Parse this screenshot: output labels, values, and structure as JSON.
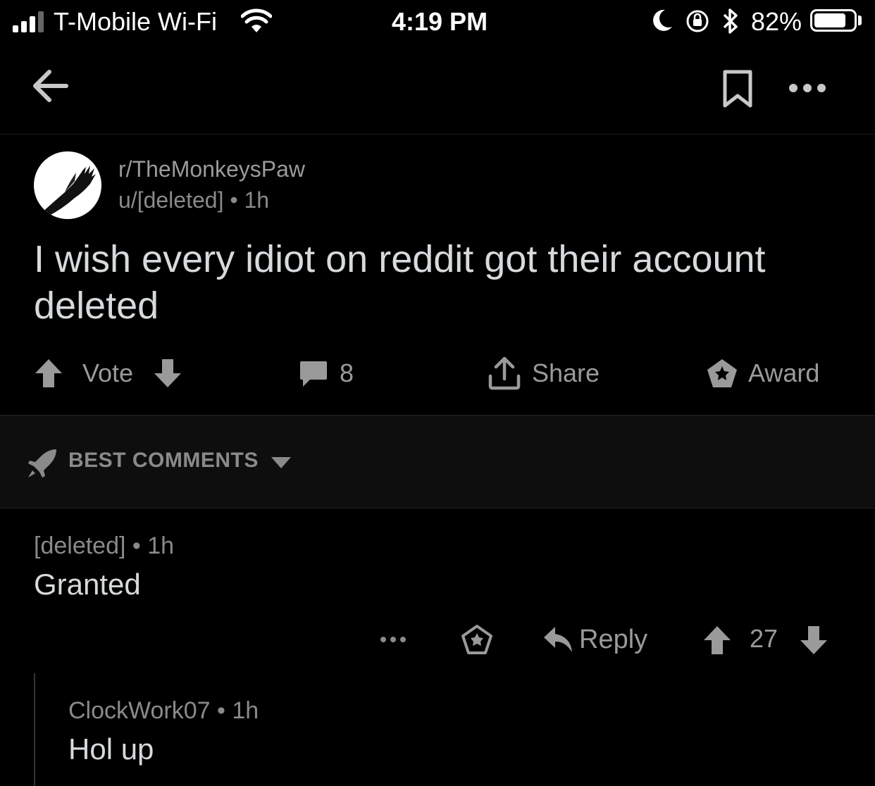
{
  "status_bar": {
    "carrier": "T-Mobile Wi-Fi",
    "time": "4:19 PM",
    "battery": "82%",
    "battery_level": 0.82,
    "icons": [
      "signal-icon",
      "wifi-icon",
      "moon-icon",
      "rotation-lock-icon",
      "bluetooth-icon",
      "battery-icon"
    ]
  },
  "nav": {
    "icons": [
      "back-arrow-icon",
      "bookmark-icon",
      "more-icon"
    ]
  },
  "post": {
    "subreddit": "r/TheMonkeysPaw",
    "author": "u/[deleted]",
    "age": "1h",
    "title": "I wish every idiot on reddit got their account deleted",
    "actions": {
      "vote": "Vote",
      "comments": "8",
      "share": "Share",
      "award": "Award"
    }
  },
  "sort": {
    "label": "BEST COMMENTS",
    "icons": [
      "rocket-icon",
      "caret-down-icon"
    ]
  },
  "comments": [
    {
      "author": "[deleted]",
      "age": "1h",
      "body": "Granted",
      "reply_label": "Reply",
      "score": "27"
    },
    {
      "author": "ClockWork07",
      "age": "1h",
      "body": "Hol up"
    }
  ],
  "colors": {
    "background": "#000000",
    "text": "#d7dadc",
    "muted": "#8a8a8a",
    "sortbar": "#0e0e0e"
  }
}
